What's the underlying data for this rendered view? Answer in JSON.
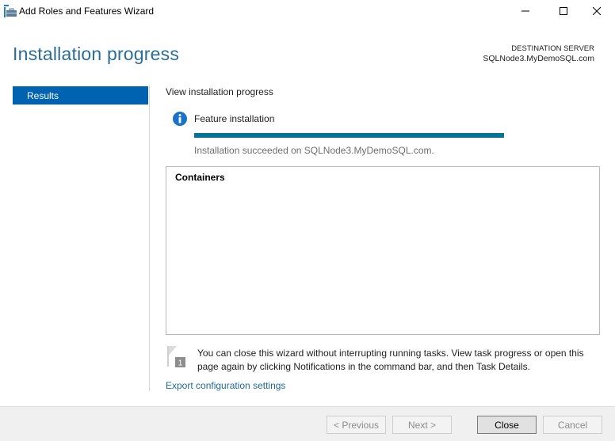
{
  "window": {
    "title": "Add Roles and Features Wizard",
    "controls": [
      "minimize",
      "maximize",
      "close"
    ]
  },
  "header": {
    "page_title": "Installation progress",
    "destination_label": "DESTINATION SERVER",
    "destination_server": "SQLNode3.MyDemoSQL.com"
  },
  "sidebar": {
    "items": [
      {
        "label": "Results",
        "selected": true
      }
    ]
  },
  "main": {
    "section_heading": "View installation progress",
    "feature_label": "Feature installation",
    "progress_percent": 100,
    "status_text": "Installation succeeded on SQLNode3.MyDemoSQL.com.",
    "results": [
      "Containers"
    ],
    "note_text": "You can close this wizard without interrupting running tasks. View task progress or open this page again by clicking Notifications in the command bar, and then Task Details.",
    "notification_badge": "1",
    "export_link": "Export configuration settings"
  },
  "footer": {
    "previous_label": "< Previous",
    "next_label": "Next >",
    "close_label": "Close",
    "cancel_label": "Cancel"
  },
  "colors": {
    "accent": "#0063b1",
    "title": "#2c6d96",
    "progress": "#047596",
    "link": "#1f6b98",
    "info": "#1a73c8"
  }
}
